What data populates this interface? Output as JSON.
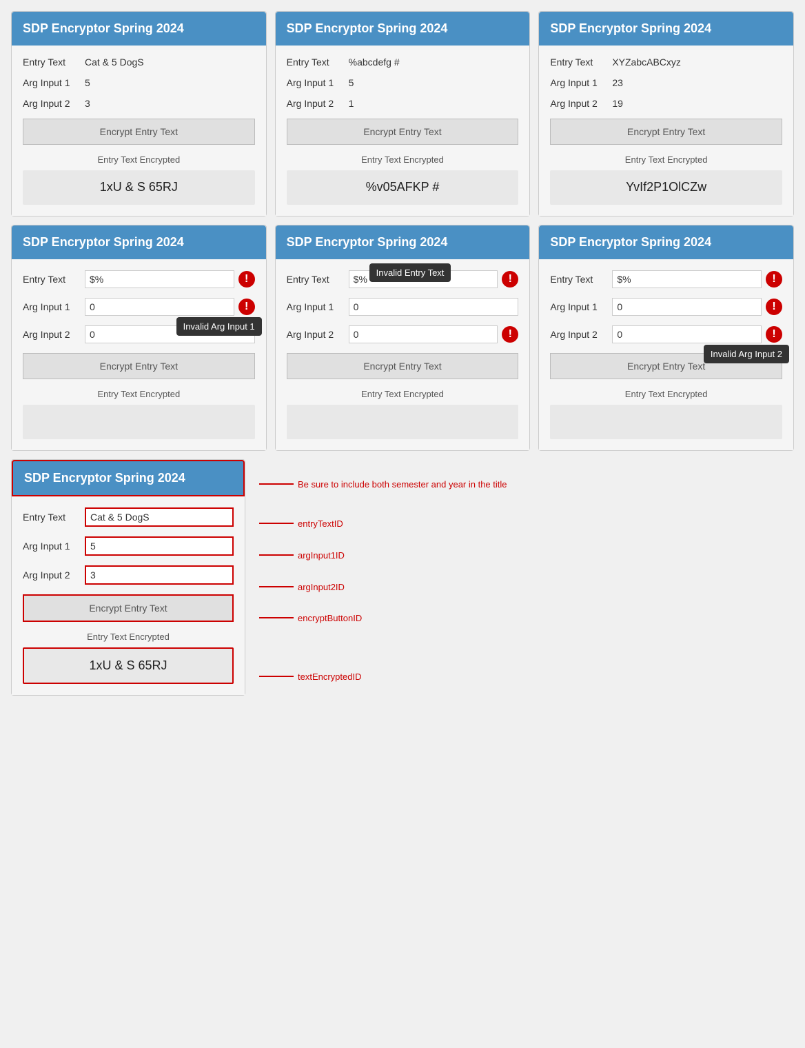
{
  "app": {
    "title": "SDP Encryptor Spring 2024"
  },
  "row1": {
    "card1": {
      "entry_text_label": "Entry Text",
      "entry_text_value": "Cat & 5 DogS",
      "arg1_label": "Arg Input 1",
      "arg1_value": "5",
      "arg2_label": "Arg Input 2",
      "arg2_value": "3",
      "btn_label": "Encrypt Entry Text",
      "result_label": "Entry Text Encrypted",
      "result_value": "1xU & S 65RJ"
    },
    "card2": {
      "entry_text_label": "Entry Text",
      "entry_text_value": "%abcdefg #",
      "arg1_label": "Arg Input 1",
      "arg1_value": "5",
      "arg2_label": "Arg Input 2",
      "arg2_value": "1",
      "btn_label": "Encrypt Entry Text",
      "result_label": "Entry Text Encrypted",
      "result_value": "%v05AFKP #"
    },
    "card3": {
      "entry_text_label": "Entry Text",
      "entry_text_value": "XYZabcABCxyz",
      "arg1_label": "Arg Input 1",
      "arg1_value": "23",
      "arg2_label": "Arg Input 2",
      "arg2_value": "19",
      "btn_label": "Encrypt Entry Text",
      "result_label": "Entry Text Encrypted",
      "result_value": "YvIf2P1OlCZw"
    }
  },
  "row2": {
    "card1": {
      "entry_text_label": "Entry Text",
      "entry_text_value": "$%",
      "arg1_label": "Arg Input 1",
      "arg1_value": "0",
      "arg2_label": "Arg Input 2",
      "arg2_value": "0",
      "btn_label": "Encrypt Entry Text",
      "result_label": "Entry Text Encrypted",
      "result_value": "",
      "tooltip": "Invalid Arg Input 1"
    },
    "card2": {
      "entry_text_label": "Entry Text",
      "entry_text_value": "$%",
      "arg1_label": "Arg Input 1",
      "arg1_value": "0",
      "arg2_label": "Arg Input 2",
      "arg2_value": "0",
      "btn_label": "Encrypt Entry Text",
      "result_label": "Entry Text Encrypted",
      "result_value": "",
      "tooltip": "Invalid Entry Text"
    },
    "card3": {
      "entry_text_label": "Entry Text",
      "entry_text_value": "$%",
      "arg1_label": "Arg Input 1",
      "arg1_value": "0",
      "arg2_label": "Arg Input 2",
      "arg2_value": "0",
      "btn_label": "Encrypt Entry Text",
      "result_label": "Entry Text Encrypted",
      "result_value": "",
      "tooltip": "Invalid Arg Input 2"
    }
  },
  "bottom": {
    "header": "SDP Encryptor Spring 2024",
    "entry_text_label": "Entry Text",
    "entry_text_value": "Cat & 5 DogS",
    "arg1_label": "Arg Input 1",
    "arg1_value": "5",
    "arg2_label": "Arg Input 2",
    "arg2_value": "3",
    "btn_label": "Encrypt Entry Text",
    "result_label": "Entry Text Encrypted",
    "result_value": "1xU & S 65RJ",
    "annotations": {
      "header_note": "Be sure to include both semester and year in the title",
      "entry_id": "entryTextID",
      "arg1_id": "argInput1ID",
      "arg2_id": "argInput2ID",
      "btn_id": "encryptButtonID",
      "result_id": "textEncryptedID"
    }
  }
}
